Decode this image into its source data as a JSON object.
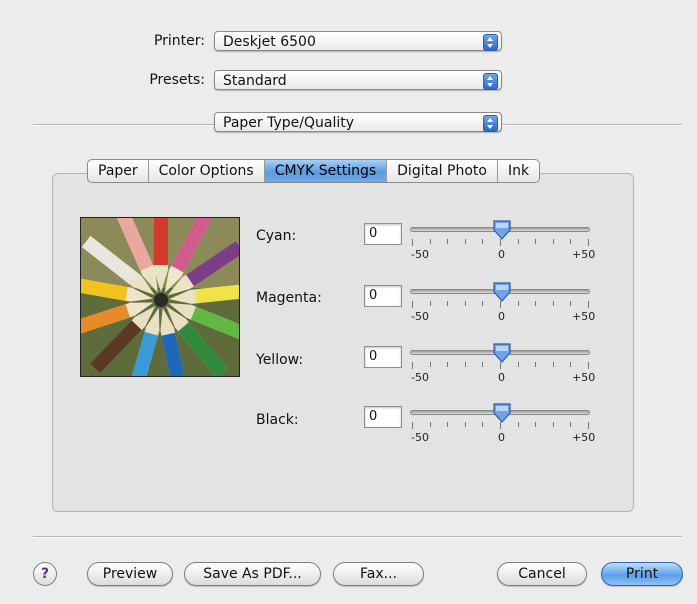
{
  "form": {
    "printer_label": "Printer:",
    "printer_value": "Deskjet 6500",
    "presets_label": "Presets:",
    "presets_value": "Standard",
    "panel_value": "Paper Type/Quality"
  },
  "tabs": [
    {
      "label": "Paper",
      "active": false
    },
    {
      "label": "Color Options",
      "active": false
    },
    {
      "label": "CMYK Settings",
      "active": true
    },
    {
      "label": "Digital Photo",
      "active": false
    },
    {
      "label": "Ink",
      "active": false
    }
  ],
  "sliders": [
    {
      "label": "Cyan:",
      "value": "0",
      "min": -50,
      "max": 50
    },
    {
      "label": "Magenta:",
      "value": "0",
      "min": -50,
      "max": 50
    },
    {
      "label": "Yellow:",
      "value": "0",
      "min": -50,
      "max": 50
    },
    {
      "label": "Black:",
      "value": "0",
      "min": -50,
      "max": 50
    }
  ],
  "tick_labels": {
    "min": "-50",
    "mid": "0",
    "max": "+50"
  },
  "buttons": {
    "help": "?",
    "preview": "Preview",
    "save_pdf": "Save As PDF...",
    "fax": "Fax...",
    "cancel": "Cancel",
    "print": "Print"
  },
  "colors": {
    "accent": "#5b9be0",
    "help_icon": "#5b2d91"
  },
  "icons": [
    "popup-arrows-icon",
    "slider-thumb-icon",
    "help-icon"
  ]
}
